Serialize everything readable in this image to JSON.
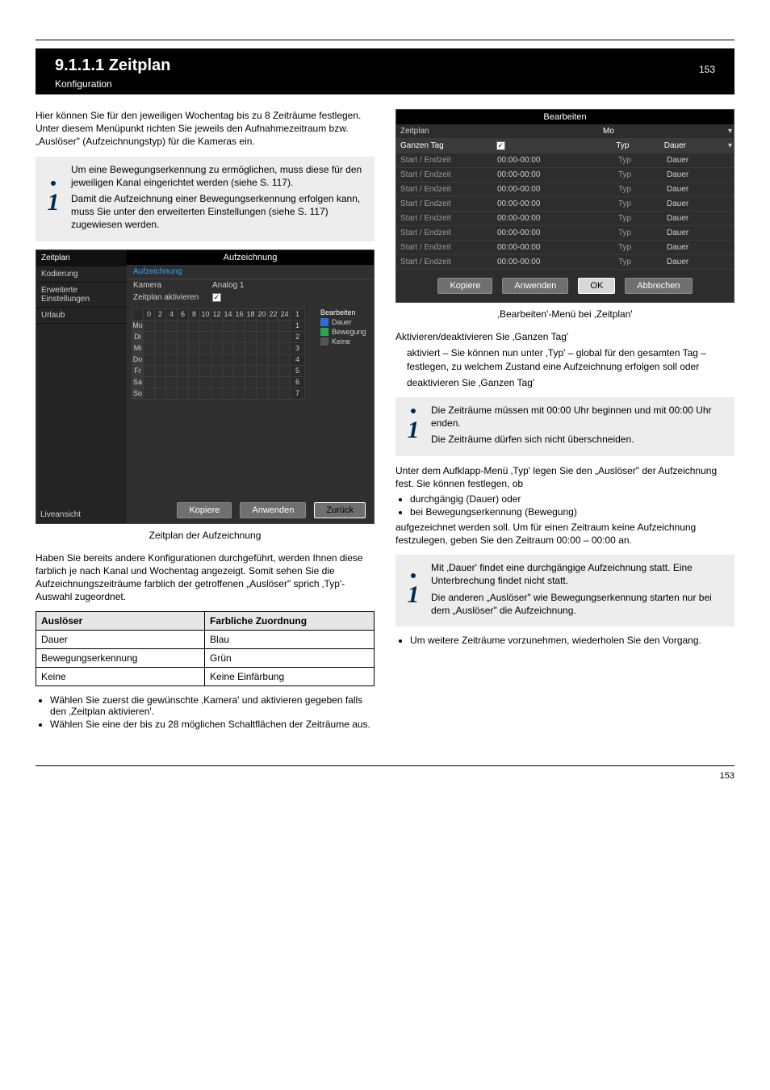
{
  "header": {
    "title": "9.1.1.1 Zeitplan",
    "pageref": "153",
    "sub": "Konfiguration"
  },
  "left": {
    "intro1": "Hier können Sie für den jeweiligen Wochentag bis zu 8 Zeiträume festlegen. Unter diesem Menüpunkt richten Sie jeweils den Aufnahmezeitraum bzw. „Auslöser\" (Aufzeichnungstyp) für die Kameras ein.",
    "info1_l1": "Um eine Bewegungserkennung zu ermöglichen, muss diese für den jeweiligen Kanal eingerichtet werden (siehe S. 117).",
    "info1_l2": "Damit die Aufzeichnung einer Bewegungserkennung erfolgen kann, muss Sie unter den erweiterten Einstellungen (siehe S. 117) zugewiesen werden.",
    "sched_caption": "Zeitplan der Aufzeichnung",
    "below_sched": "Haben Sie bereits andere Konfigurationen durchgeführt, werden Ihnen diese farblich je nach Kanal und Wochentag angezeigt. Somit sehen Sie die Aufzeichnungszeiträume farblich der getroffenen „Auslöser\" sprich ‚Typ'-Auswahl zugeordnet.",
    "table": {
      "h1": "Auslöser",
      "h2": "Farbliche Zuordnung",
      "r1c1": "Dauer",
      "r1c2": "Blau",
      "r2c1": "Bewegungserkennung",
      "r2c2": "Grün",
      "r3c1": "Keine",
      "r3c2": "Keine Einfärbung"
    },
    "bul1": "Wählen Sie zuerst die gewünschte ‚Kamera' und aktivieren gegeben falls den ‚Zeitplan aktivieren'.",
    "bul2": "Wählen Sie eine der bis zu 28 möglichen Schaltflächen der Zeiträume aus."
  },
  "right": {
    "edit_title": "Bearbeiten",
    "sched_label": "Zeitplan",
    "sched_value": "Mo",
    "allday": "Ganzen Tag",
    "range_label": "Start / Endzeit",
    "range_value": "00:00-00:00",
    "type_label": "Typ",
    "type_value": "Dauer",
    "btn_copy": "Kopiere",
    "btn_apply": "Anwenden",
    "btn_ok": "OK",
    "btn_cancel": "Abbrechen",
    "edit_caption": "‚Bearbeiten'-Menü bei ‚Zeitplan'",
    "r_p1": "Aktivieren/deaktivieren Sie ‚Ganzen Tag'",
    "r_all_on": "aktiviert – Sie können nun unter ‚Typ' – global für den gesamten Tag – festlegen, zu welchem Zustand eine Aufzeichnung erfolgen soll oder",
    "r_all_off": "deaktivieren Sie ‚Ganzen Tag'",
    "info2_l1": "Die Zeiträume müssen mit 00:00 Uhr beginnen und mit 00:00 Uhr enden.",
    "info2_l2": "Die Zeiträume dürfen sich nicht überschneiden.",
    "r_type_intro": "Unter dem Aufklapp-Menü ‚Typ' legen Sie den „Auslöser\" der Aufzeichnung fest. Sie können festlegen, ob",
    "r_type_b1": "durchgängig (Dauer) oder",
    "r_type_b2": "bei Bewegungserkennung (Bewegung)",
    "r_type_after": "aufgezeichnet werden soll. Um für einen Zeitraum keine Aufzeichnung festzulegen, geben Sie den Zeitraum 00:00 – 00:00 an.",
    "info3_l1": "Mit ‚Dauer' findet eine durchgängige Aufzeichnung statt. Eine Unterbrechung findet nicht statt.",
    "info3_l2": "Die anderen „Auslöser\" wie Bewegungserkennung starten nur bei dem „Auslöser\" die Aufzeichnung.",
    "end_bul": "Um weitere Zeiträume vorzunehmen, wiederholen Sie den Vorgang."
  },
  "sched_shot": {
    "title": "Aufzeichnung",
    "side": {
      "items": [
        "Zeitplan",
        "Kodierung",
        "Erweiterte Einstellungen",
        "Urlaub"
      ],
      "sel": 0
    },
    "tab": "Aufzeichnung",
    "row_cam_label": "Kamera",
    "row_cam_value": "Analog 1",
    "row_enable": "Zeitplan aktivieren",
    "hours": [
      "0",
      "2",
      "4",
      "6",
      "8",
      "10",
      "12",
      "14",
      "16",
      "18",
      "20",
      "22",
      "24"
    ],
    "days": [
      "Mo",
      "Di",
      "Mi",
      "Do",
      "Fr",
      "Sa",
      "So"
    ],
    "ids": [
      "1",
      "2",
      "3",
      "4",
      "5",
      "6",
      "7"
    ],
    "legend_edit": "Bearbeiten",
    "legend_items": [
      {
        "c": "#2a6fd6",
        "t": "Dauer"
      },
      {
        "c": "#2aa84f",
        "t": "Bewegung"
      },
      {
        "c": "#777",
        "t": "Keine"
      }
    ],
    "live": "Liveansicht",
    "btn_copy": "Kopiere",
    "btn_apply": "Anwenden",
    "btn_back": "Zurück"
  },
  "footer": "153"
}
